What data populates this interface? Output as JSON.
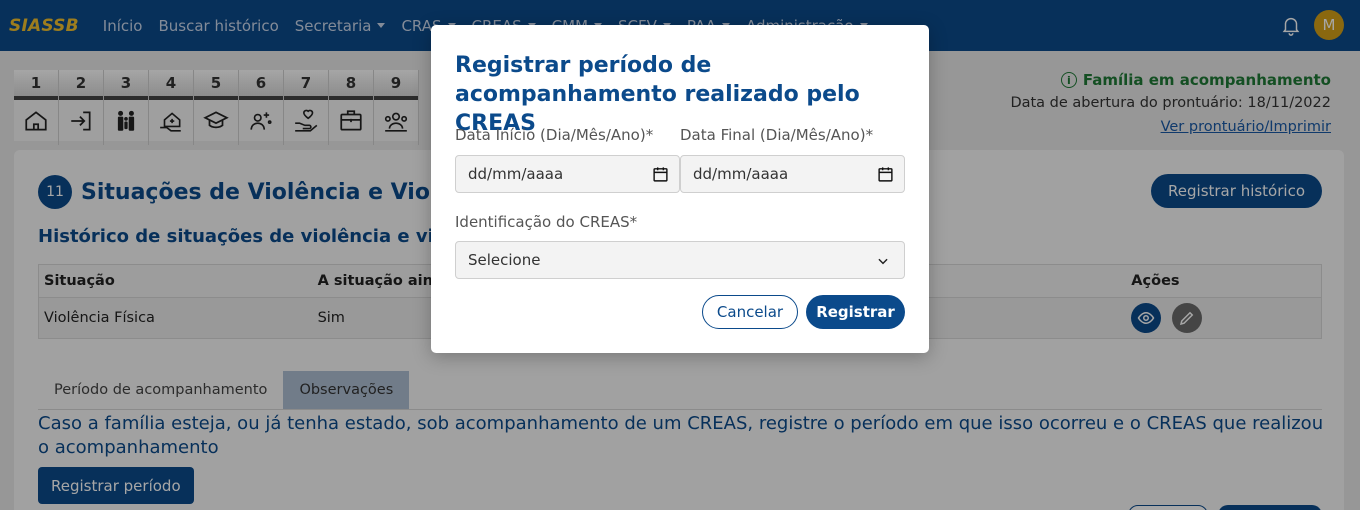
{
  "navbar": {
    "brand": "SIASSB",
    "items": [
      {
        "label": "Início",
        "dropdown": false
      },
      {
        "label": "Buscar histórico",
        "dropdown": false
      },
      {
        "label": "Secretaria",
        "dropdown": true
      },
      {
        "label": "CRAS",
        "dropdown": true
      },
      {
        "label": "CREAS",
        "dropdown": true
      },
      {
        "label": "CMM",
        "dropdown": true
      },
      {
        "label": "SCFV",
        "dropdown": true
      },
      {
        "label": "PAA",
        "dropdown": true
      },
      {
        "label": "Administração",
        "dropdown": true
      }
    ],
    "avatar_initial": "M"
  },
  "steps": [
    {
      "number": "1",
      "icon": "home-icon"
    },
    {
      "number": "2",
      "icon": "login-icon"
    },
    {
      "number": "3",
      "icon": "family-icon"
    },
    {
      "number": "4",
      "icon": "house-care-icon"
    },
    {
      "number": "5",
      "icon": "graduation-cap-icon"
    },
    {
      "number": "6",
      "icon": "health-person-icon"
    },
    {
      "number": "7",
      "icon": "hand-heart-icon"
    },
    {
      "number": "8",
      "icon": "briefcase-icon"
    },
    {
      "number": "9",
      "icon": "group-icon"
    }
  ],
  "family_info": {
    "status": "Família em acompanhamento",
    "open_date": "Data de abertura do prontuário: 18/11/2022",
    "print_link": "Ver prontuário/Imprimir"
  },
  "section": {
    "number": "11",
    "title": "Situações de Violência e Violações de Direitos",
    "register_history_button": "Registrar histórico",
    "history_title": "Histórico de situações de violência e violações de direitos",
    "table": {
      "headers": [
        "Situação",
        "A situação ainda ocorre?",
        "Ações"
      ],
      "rows": [
        {
          "situacao": "Violência Física",
          "ocorre": "Sim"
        }
      ]
    },
    "tabs": [
      "Período de acompanhamento",
      "Observações"
    ],
    "creas_text": "Caso a família esteja, ou já tenha estado, sob acompanhamento de um CREAS, registre o período em que isso ocorreu e o CREAS que realizou o acompanhamento",
    "register_period_button": "Registrar período"
  },
  "modal": {
    "title": "Registrar período de acompanhamento realizado pelo CREAS",
    "start_label": "Data Início (Dia/Mês/Ano)*",
    "end_label": "Data Final (Dia/Mês/Ano)*",
    "date_placeholder": "dd/mm/aaaa",
    "creas_label": "Identificação do CREAS*",
    "select_value": "Selecione",
    "cancel_button": "Cancelar",
    "register_button": "Registrar"
  },
  "colors": {
    "primary": "#0b4a8b",
    "brand": "#f2c12e",
    "success": "#1f7a36",
    "avatar": "#d4a017"
  }
}
